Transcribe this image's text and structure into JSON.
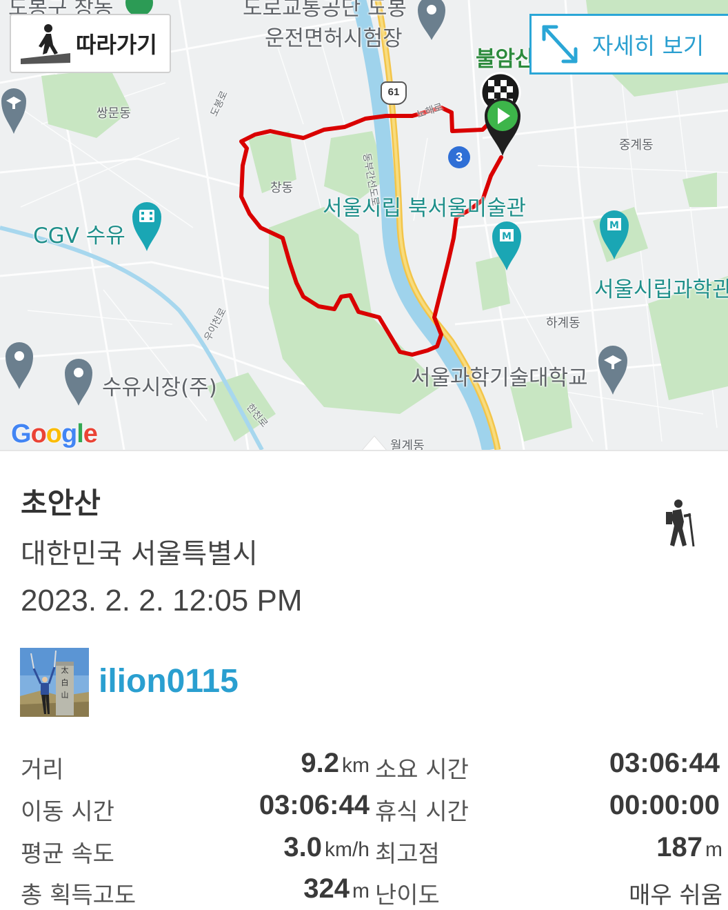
{
  "map": {
    "follow_label": "따라가기",
    "detail_label": "자세히 보기",
    "labels": {
      "license_office": "운전면허시험장",
      "transport_hall": "도로교통공단 도봉",
      "bulamsan": "불암산",
      "ssangmun": "쌍문동",
      "changdong": "창동",
      "museum": "서울시립 북서울미술관",
      "cgv": "CGV 수유",
      "science_museum": "서울시립과학관",
      "junggye": "중계동",
      "hagye": "하계동",
      "university": "서울과학기술대학교",
      "suyu_market": "수유시장(주)",
      "wolgye": "월계동",
      "route_61": "61",
      "line_3": "3",
      "road_nohae": "노해로",
      "road_dobong": "도봉로",
      "road_dongbu": "동부간선도로",
      "road_ui": "우이천로",
      "road_hancheon": "한천로",
      "top_cut": "도봉구 창동",
      "google": "Google"
    },
    "route_color": "#d90000"
  },
  "trip": {
    "title": "초안산",
    "region": "대한민국 서울특별시",
    "datetime": "2023. 2. 2. 12:05 PM",
    "activity_icon": "hiking-icon"
  },
  "user": {
    "name": "ilion0115",
    "avatar_icon": "user-avatar"
  },
  "stats": {
    "distance_label": "거리",
    "distance_value": "9.2",
    "distance_unit": "km",
    "duration_label": "소요 시간",
    "duration_value": "03:06:44",
    "moving_label": "이동 시간",
    "moving_value": "03:06:44",
    "rest_label": "휴식 시간",
    "rest_value": "00:00:00",
    "speed_label": "평균 속도",
    "speed_value": "3.0",
    "speed_unit": "km/h",
    "peak_label": "최고점",
    "peak_value": "187",
    "peak_unit": "m",
    "gain_label": "총 획득고도",
    "gain_value": "324",
    "gain_unit": "m",
    "difficulty_label": "난이도",
    "difficulty_value": "매우 쉬움"
  }
}
